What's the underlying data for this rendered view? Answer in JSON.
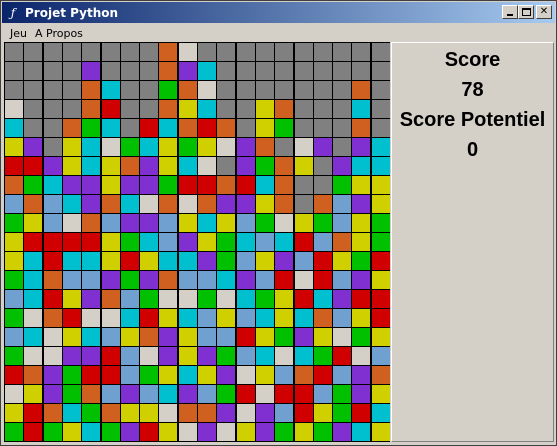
{
  "window": {
    "title": "Projet Python",
    "icon": "feather-icon",
    "buttons": [
      "minimize",
      "maximize",
      "close"
    ]
  },
  "menu": {
    "items": [
      "Jeu",
      "A Propos"
    ]
  },
  "panel": {
    "score_label": "Score",
    "score_value": "78",
    "potential_label": "Score Potentiel",
    "potential_value": "0"
  },
  "colors": {
    "G": "#808080",
    "Y": "#d0d000",
    "R": "#d00000",
    "C": "#00c0d0",
    "P": "#8030d0",
    "O": "#d06020",
    "N": "#00c000",
    "W": "#d4d0c8",
    "B": "#70a0d0"
  },
  "board": {
    "cols": 20,
    "rows": 21,
    "grid": [
      "GGGGGGGGOWGGGGGGGGGG",
      "GGGGPGGGOPCGGGGGGGGG",
      "GGGGOCGGNOWGGGGGGGOG",
      "WGGGORGGOYCGGYOGGGCG",
      "CGGONCGRCOROGYNGGGOG",
      "YPGYCWNCYNYWPOGWPGPC",
      "RRPYCYOPYCWGPNOYGPCC",
      "ONCPPYPPNRRORCOGGNYY",
      "BOBCPOCWOWOPPYOGOBPY",
      "NYBWOBPPBYCYBNWYNBYN",
      "YRRRRYNCBPYNCBCRBOYN",
      "YCRCCYRYCCPNBYPBRYNR",
      "NCOBBPNPOBBCPBRWRBPY",
      "BCRYPOBNWWNWCNYRCPRR",
      "NWORWWCRYCBYBCYCOBYR",
      "BCWYCBYOPYBBRYNPYWNY",
      "NWWPPRBWPYPNBCWCNRWB",
      "ROPNRRBNYCYPWYBORBPO",
      "WYPNOBPBCPBNRWRRBNPY",
      "YROCNOYYWOOPWPBRYNRC",
      "NRNYCNPRYWPWYPNYNPCY"
    ]
  }
}
